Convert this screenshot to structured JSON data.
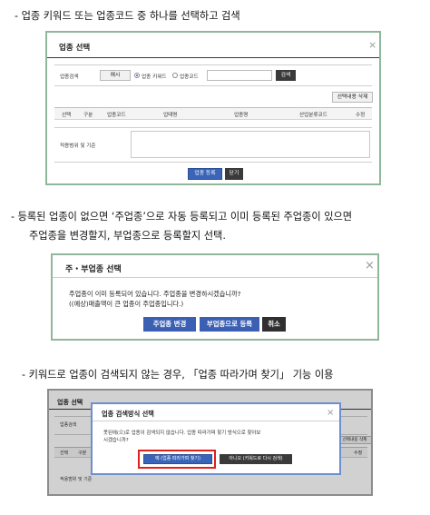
{
  "bullets": {
    "b1": "- 업종 키워드 또는 업종코드 중 하나를 선택하고 검색",
    "b2_line1": "- 등록된 업종이 없으면 ‘주업종’으로 자동 등록되고 이미 등록된 주업종이 있으면",
    "b2_line2": "주업종을 변경할지, 부업종으로 등록할지 선택.",
    "b3": "- 키워드로 업종이 검색되지 않는 경우, 「업종 따라가며 찾기」 기능 이용"
  },
  "panel1": {
    "title": "업종 선택",
    "close": "×",
    "search_label": "업종검색",
    "example_button": "예시",
    "radio_keyword": "업종 키워드",
    "radio_code": "업종코드",
    "search_button": "검색",
    "delete_selected_button": "선택내용 삭제",
    "columns": [
      "선택",
      "구분",
      "업종코드",
      "업태명",
      "업종명",
      "산업분류코드",
      "수정"
    ],
    "scope_label": "적용범위 및 기준",
    "register_button": "업종 등록",
    "close_button": "닫기"
  },
  "panel2": {
    "title": "주・부업종 선택",
    "close": "×",
    "message_line1": "주업종이 이미 등록되어 있습니다. 주업종을 변경하시겠습니까?",
    "message_line2": "((예상)매출액이 큰 업종이 주업종입니다.)",
    "change_main_button": "주업종 변경",
    "register_sub_button": "부업종으로 등록",
    "cancel_button": "취소"
  },
  "panel3": {
    "bg_title": "업종 선택",
    "bg_search_label": "업종검색",
    "bg_col_select": "선택",
    "bg_col_gubun": "구분",
    "bg_col_edit": "수정",
    "bg_scope_label": "적용범위 및 기준",
    "bg_delete_button": "선택내용 삭제",
    "modal_title": "업종 검색방식 선택",
    "close": "×",
    "modal_message_line1": "못된에(으)로 업종이 검색되지 않습니다. 업종 따라가며 찾기 방식으로 찾아보",
    "modal_message_line2": "시겠습니까?",
    "yes_button": "예 (업종 따라가며 찾기)",
    "no_button": "아니오 (키워드로 다시 검색)"
  },
  "colors": {
    "frame_border": "#8fb89a",
    "blue_button": "#3a64b8",
    "dark_button": "#3a3a3a",
    "highlight_red": "#e0201a",
    "modal_border": "#6d8fcf"
  }
}
